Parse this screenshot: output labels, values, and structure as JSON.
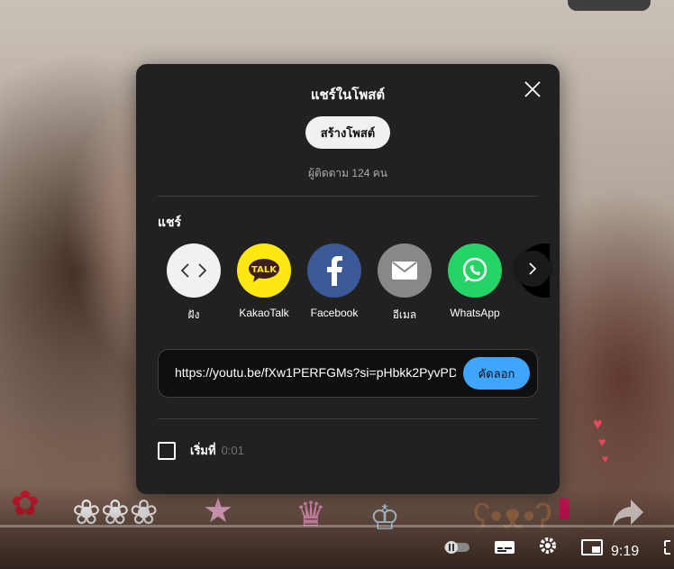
{
  "dialog": {
    "title": "แชร์ในโพสต์",
    "create_post_label": "สร้างโพสต์",
    "subscribers_text": "ผู้ติดตาม 124 คน",
    "share_heading": "แชร์",
    "share_targets": [
      {
        "label": "ฝัง",
        "icon": "embed-icon",
        "color": "#f1f1f1"
      },
      {
        "label": "KakaoTalk",
        "icon": "kakaotalk-icon",
        "color": "#ffe812"
      },
      {
        "label": "Facebook",
        "icon": "facebook-icon",
        "color": "#3b5998"
      },
      {
        "label": "อีเมล",
        "icon": "email-icon",
        "color": "#888888"
      },
      {
        "label": "WhatsApp",
        "icon": "whatsapp-icon",
        "color": "#25d366"
      }
    ],
    "share_url": "https://youtu.be/fXw1PERFGMs?si=pHbkk2PyvPD",
    "copy_label": "คัดลอก",
    "start_at_label": "เริ่มที่",
    "start_at_time": "0:01"
  },
  "player": {
    "time_partial": "9:19"
  },
  "colors": {
    "dialog_bg": "#212121",
    "accent_blue": "#3ea6ff"
  }
}
